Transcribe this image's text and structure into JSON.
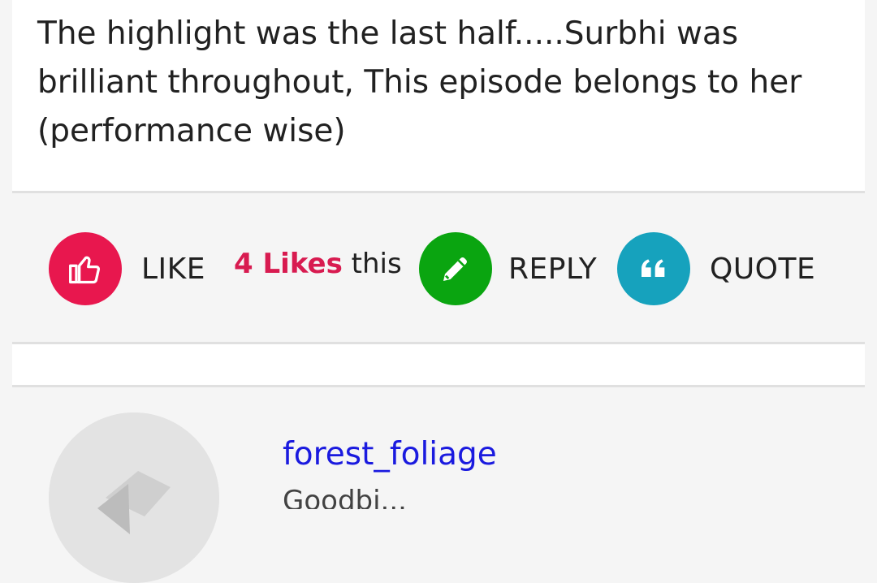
{
  "post": {
    "text": "The highlight was the last half.....Surbhi was brilliant throughout, This episode belongs to her (performance wise)"
  },
  "actions": {
    "like_label": "LIKE",
    "likes_count": "4 Likes",
    "likes_suffix": "this",
    "reply_label": "REPLY",
    "quote_label": "QUOTE"
  },
  "colors": {
    "like": "#e8174e",
    "reply": "#0aa510",
    "quote": "#16a2bd",
    "username": "#1a1adf",
    "likes_count": "#d81b50"
  },
  "next_post": {
    "username": "forest_foliage",
    "subline": "Goodbi..."
  },
  "icons": {
    "like": "thumbs-up-icon",
    "reply": "pencil-icon",
    "quote": "quote-icon",
    "avatar": "avatar-placeholder-icon"
  }
}
